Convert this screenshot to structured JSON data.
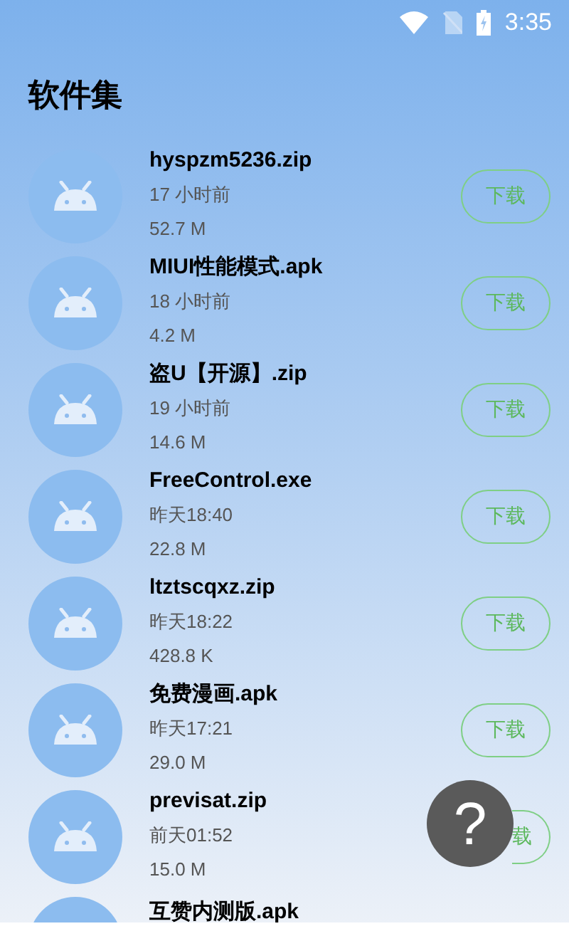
{
  "status_bar": {
    "time": "3:35"
  },
  "title": "软件集",
  "files": [
    {
      "kind": "full",
      "name": "hyspzm5236.zip",
      "time": "17 小时前",
      "size": "52.7 M",
      "button": "下载"
    },
    {
      "kind": "full",
      "name": "MIUI性能模式.apk",
      "time": "18 小时前",
      "size": "4.2 M",
      "button": "下载"
    },
    {
      "kind": "full",
      "name": "盗U【开源】.zip",
      "time": "19 小时前",
      "size": "14.6 M",
      "button": "下载"
    },
    {
      "kind": "full",
      "name": "FreeControl.exe",
      "time": "昨天18:40",
      "size": "22.8 M",
      "button": "下载"
    },
    {
      "kind": "full",
      "name": "ltztscqxz.zip",
      "time": "昨天18:22",
      "size": "428.8 K",
      "button": "下载"
    },
    {
      "kind": "full",
      "name": "免费漫画.apk",
      "time": "昨天17:21",
      "size": "29.0 M",
      "button": "下载"
    },
    {
      "kind": "covered",
      "name": "previsat.zip",
      "time": "前天01:52",
      "size": "15.0 M",
      "button": "载"
    },
    {
      "kind": "cut",
      "name": "互赞内测版.apk"
    }
  ],
  "help_button": {
    "label": "?"
  }
}
